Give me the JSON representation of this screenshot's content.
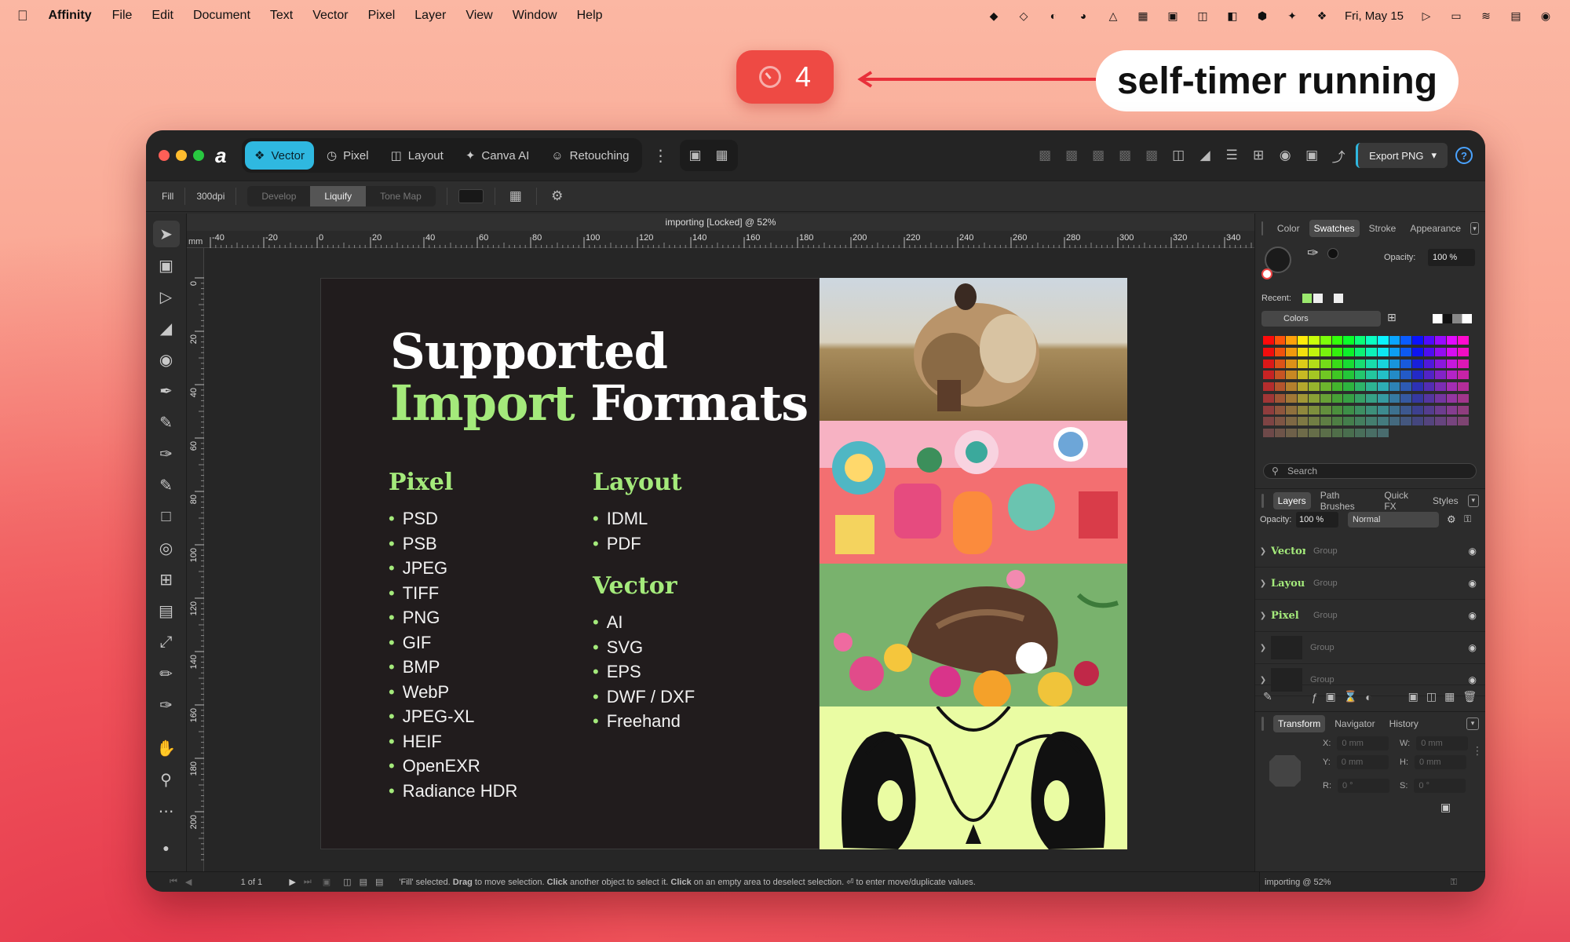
{
  "menubar": {
    "app_name": "Affinity",
    "items": [
      "File",
      "Edit",
      "Document",
      "Text",
      "Vector",
      "Pixel",
      "Layer",
      "View",
      "Window",
      "Help"
    ],
    "date": "Fri, May 15"
  },
  "overlay": {
    "timer_value": "4",
    "callout_text": "self-timer running"
  },
  "window": {
    "personas": [
      {
        "label": "Vector",
        "icon": "vector-persona-icon"
      },
      {
        "label": "Pixel",
        "icon": "pixel-persona-icon"
      },
      {
        "label": "Layout",
        "icon": "layout-persona-icon"
      },
      {
        "label": "Canva AI",
        "icon": "sparkle-icon"
      },
      {
        "label": "Retouching",
        "icon": "person-icon"
      }
    ],
    "export_label": "Export PNG",
    "help_label": "?"
  },
  "contextbar": {
    "fill_label": "Fill",
    "dpi": "300dpi",
    "modes": [
      "Develop",
      "Liquify",
      "Tone Map"
    ],
    "active_mode": "Liquify"
  },
  "canvas": {
    "doc_title": "importing [Locked] @ 52%",
    "ruler_unit": "mm",
    "h_ticks": [
      "-40",
      "-20",
      "0",
      "20",
      "40",
      "60",
      "80",
      "100",
      "120",
      "140",
      "160",
      "180",
      "200",
      "220",
      "240",
      "260",
      "280",
      "300",
      "320",
      "340"
    ],
    "v_ticks": [
      "0",
      "20",
      "40",
      "60",
      "80",
      "100",
      "120",
      "140",
      "160",
      "180",
      "200"
    ]
  },
  "artboard": {
    "headline_line1": "Supported",
    "headline_green": "Import",
    "headline_rest": "Formats",
    "pixel_title": "Pixel",
    "pixel_formats": [
      "PSD",
      "PSB",
      "JPEG",
      "TIFF",
      "PNG",
      "GIF",
      "BMP",
      "WebP",
      "JPEG-XL",
      "HEIF",
      "OpenEXR",
      "Radiance HDR"
    ],
    "layout_title": "Layout",
    "layout_formats": [
      "IDML",
      "PDF"
    ],
    "vector_title": "Vector",
    "vector_formats": [
      "AI",
      "SVG",
      "EPS",
      "DWF / DXF",
      "Freehand"
    ]
  },
  "color_panel": {
    "tabs": [
      "Color",
      "Swatches",
      "Stroke",
      "Appearance"
    ],
    "active_tab": "Swatches",
    "opacity_label": "Opacity:",
    "opacity_value": "100 %",
    "recent_label": "Recent:",
    "palette_label": "Colors",
    "search_placeholder": "Search"
  },
  "layers_panel": {
    "tabs": [
      "Layers",
      "Path Brushes",
      "Quick FX",
      "Styles"
    ],
    "active_tab": "Layers",
    "opacity_label": "Opacity:",
    "opacity_value": "100 %",
    "blend_mode": "Normal",
    "layers": [
      {
        "thumb": "Vector",
        "name": "Group"
      },
      {
        "thumb": "Layout",
        "name": "Group"
      },
      {
        "thumb": "Pixel",
        "name": "Group"
      },
      {
        "thumb": "",
        "name": "Group"
      },
      {
        "thumb": "",
        "name": "Group"
      }
    ]
  },
  "transform_panel": {
    "tabs": [
      "Transform",
      "Navigator",
      "History"
    ],
    "active_tab": "Transform",
    "x_label": "X:",
    "x_value": "0 mm",
    "y_label": "Y:",
    "y_value": "0 mm",
    "w_label": "W:",
    "w_value": "0 mm",
    "h_label": "H:",
    "h_value": "0 mm",
    "r_label": "R:",
    "r_value": "0 °",
    "s_label": "S:",
    "s_value": "0 °"
  },
  "statusbar": {
    "page": "1 of 1",
    "hint_quote": "'Fill' selected.",
    "hint_drag": "Drag",
    "hint_1": "to move selection.",
    "hint_click1": "Click",
    "hint_2": "another object to select it.",
    "hint_click2": "Click",
    "hint_3": "on an empty area to deselect selection.",
    "hint_4": "to enter move/duplicate values.",
    "right_status": "importing @ 52%"
  },
  "colors": {
    "accent": "#2fb8e0",
    "green": "#a4ea7b",
    "timer_red": "#ee4a44"
  }
}
